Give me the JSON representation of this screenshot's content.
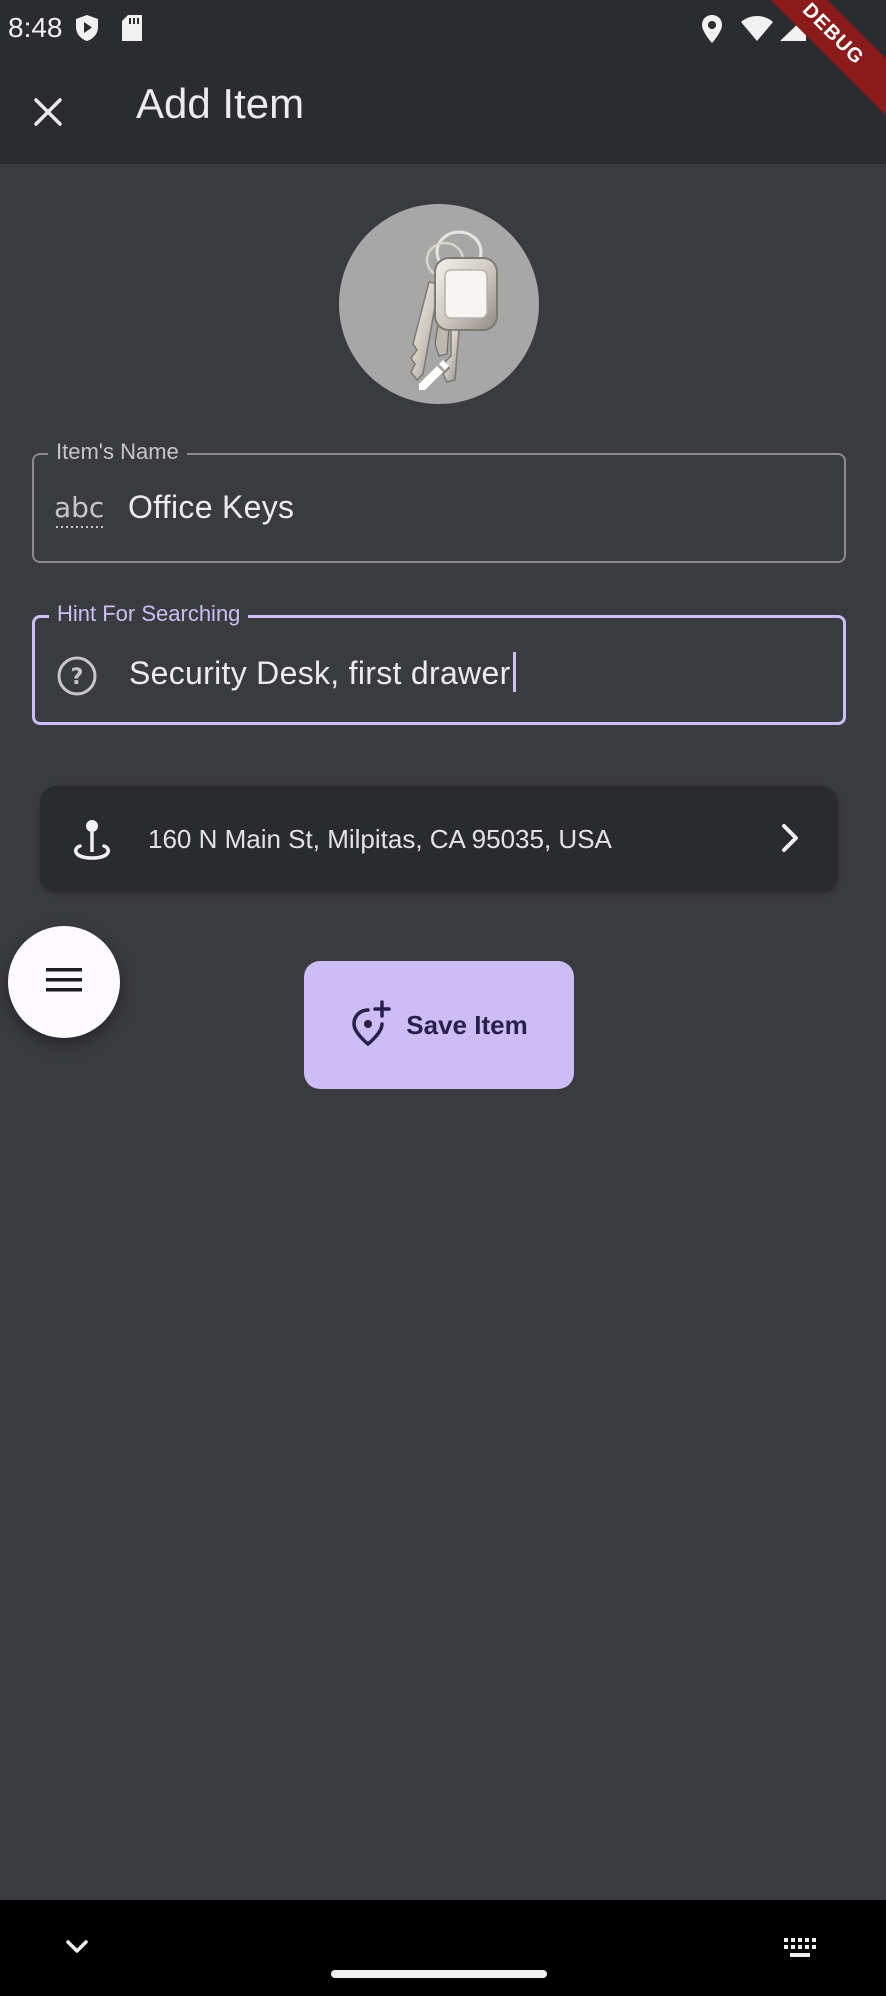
{
  "status_bar": {
    "time": "8:48",
    "icons": [
      "shield-play-icon",
      "sd-card-icon",
      "location-icon",
      "wifi-icon",
      "signal-icon",
      "battery-icon"
    ]
  },
  "debug_banner": "DEBUG",
  "app_bar": {
    "title": "Add Item",
    "close_icon": "close-icon"
  },
  "item_image": {
    "description_icon": "keys-image",
    "edit_icon": "pencil-icon"
  },
  "fields": {
    "name": {
      "label": "Item's Name",
      "value": "Office Keys",
      "icon": "abc-icon"
    },
    "hint": {
      "label": "Hint For Searching",
      "value": "Security Desk, first drawer",
      "icon": "help-circle-icon"
    }
  },
  "location": {
    "address": "160 N Main St, Milpitas, CA 95035, USA",
    "icon": "pin-drop-icon"
  },
  "actions": {
    "menu_icon": "menu-icon",
    "save_label": "Save Item",
    "save_icon": "add-location-icon"
  },
  "colors": {
    "background": "#3a3b3e",
    "app_bar": "#2b2c2f",
    "accent": "#cdbdf6",
    "card": "#2a2b2e"
  }
}
